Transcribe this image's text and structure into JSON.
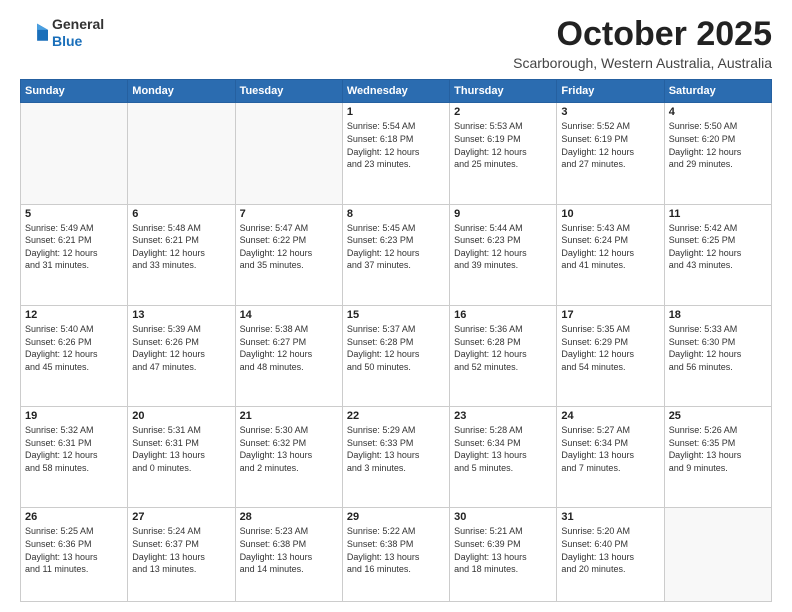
{
  "header": {
    "logo": {
      "line1": "General",
      "line2": "Blue"
    },
    "title": "October 2025",
    "subtitle": "Scarborough, Western Australia, Australia"
  },
  "calendar": {
    "weekdays": [
      "Sunday",
      "Monday",
      "Tuesday",
      "Wednesday",
      "Thursday",
      "Friday",
      "Saturday"
    ],
    "weeks": [
      [
        {
          "day": "",
          "info": ""
        },
        {
          "day": "",
          "info": ""
        },
        {
          "day": "",
          "info": ""
        },
        {
          "day": "1",
          "info": "Sunrise: 5:54 AM\nSunset: 6:18 PM\nDaylight: 12 hours\nand 23 minutes."
        },
        {
          "day": "2",
          "info": "Sunrise: 5:53 AM\nSunset: 6:19 PM\nDaylight: 12 hours\nand 25 minutes."
        },
        {
          "day": "3",
          "info": "Sunrise: 5:52 AM\nSunset: 6:19 PM\nDaylight: 12 hours\nand 27 minutes."
        },
        {
          "day": "4",
          "info": "Sunrise: 5:50 AM\nSunset: 6:20 PM\nDaylight: 12 hours\nand 29 minutes."
        }
      ],
      [
        {
          "day": "5",
          "info": "Sunrise: 5:49 AM\nSunset: 6:21 PM\nDaylight: 12 hours\nand 31 minutes."
        },
        {
          "day": "6",
          "info": "Sunrise: 5:48 AM\nSunset: 6:21 PM\nDaylight: 12 hours\nand 33 minutes."
        },
        {
          "day": "7",
          "info": "Sunrise: 5:47 AM\nSunset: 6:22 PM\nDaylight: 12 hours\nand 35 minutes."
        },
        {
          "day": "8",
          "info": "Sunrise: 5:45 AM\nSunset: 6:23 PM\nDaylight: 12 hours\nand 37 minutes."
        },
        {
          "day": "9",
          "info": "Sunrise: 5:44 AM\nSunset: 6:23 PM\nDaylight: 12 hours\nand 39 minutes."
        },
        {
          "day": "10",
          "info": "Sunrise: 5:43 AM\nSunset: 6:24 PM\nDaylight: 12 hours\nand 41 minutes."
        },
        {
          "day": "11",
          "info": "Sunrise: 5:42 AM\nSunset: 6:25 PM\nDaylight: 12 hours\nand 43 minutes."
        }
      ],
      [
        {
          "day": "12",
          "info": "Sunrise: 5:40 AM\nSunset: 6:26 PM\nDaylight: 12 hours\nand 45 minutes."
        },
        {
          "day": "13",
          "info": "Sunrise: 5:39 AM\nSunset: 6:26 PM\nDaylight: 12 hours\nand 47 minutes."
        },
        {
          "day": "14",
          "info": "Sunrise: 5:38 AM\nSunset: 6:27 PM\nDaylight: 12 hours\nand 48 minutes."
        },
        {
          "day": "15",
          "info": "Sunrise: 5:37 AM\nSunset: 6:28 PM\nDaylight: 12 hours\nand 50 minutes."
        },
        {
          "day": "16",
          "info": "Sunrise: 5:36 AM\nSunset: 6:28 PM\nDaylight: 12 hours\nand 52 minutes."
        },
        {
          "day": "17",
          "info": "Sunrise: 5:35 AM\nSunset: 6:29 PM\nDaylight: 12 hours\nand 54 minutes."
        },
        {
          "day": "18",
          "info": "Sunrise: 5:33 AM\nSunset: 6:30 PM\nDaylight: 12 hours\nand 56 minutes."
        }
      ],
      [
        {
          "day": "19",
          "info": "Sunrise: 5:32 AM\nSunset: 6:31 PM\nDaylight: 12 hours\nand 58 minutes."
        },
        {
          "day": "20",
          "info": "Sunrise: 5:31 AM\nSunset: 6:31 PM\nDaylight: 13 hours\nand 0 minutes."
        },
        {
          "day": "21",
          "info": "Sunrise: 5:30 AM\nSunset: 6:32 PM\nDaylight: 13 hours\nand 2 minutes."
        },
        {
          "day": "22",
          "info": "Sunrise: 5:29 AM\nSunset: 6:33 PM\nDaylight: 13 hours\nand 3 minutes."
        },
        {
          "day": "23",
          "info": "Sunrise: 5:28 AM\nSunset: 6:34 PM\nDaylight: 13 hours\nand 5 minutes."
        },
        {
          "day": "24",
          "info": "Sunrise: 5:27 AM\nSunset: 6:34 PM\nDaylight: 13 hours\nand 7 minutes."
        },
        {
          "day": "25",
          "info": "Sunrise: 5:26 AM\nSunset: 6:35 PM\nDaylight: 13 hours\nand 9 minutes."
        }
      ],
      [
        {
          "day": "26",
          "info": "Sunrise: 5:25 AM\nSunset: 6:36 PM\nDaylight: 13 hours\nand 11 minutes."
        },
        {
          "day": "27",
          "info": "Sunrise: 5:24 AM\nSunset: 6:37 PM\nDaylight: 13 hours\nand 13 minutes."
        },
        {
          "day": "28",
          "info": "Sunrise: 5:23 AM\nSunset: 6:38 PM\nDaylight: 13 hours\nand 14 minutes."
        },
        {
          "day": "29",
          "info": "Sunrise: 5:22 AM\nSunset: 6:38 PM\nDaylight: 13 hours\nand 16 minutes."
        },
        {
          "day": "30",
          "info": "Sunrise: 5:21 AM\nSunset: 6:39 PM\nDaylight: 13 hours\nand 18 minutes."
        },
        {
          "day": "31",
          "info": "Sunrise: 5:20 AM\nSunset: 6:40 PM\nDaylight: 13 hours\nand 20 minutes."
        },
        {
          "day": "",
          "info": ""
        }
      ]
    ]
  }
}
